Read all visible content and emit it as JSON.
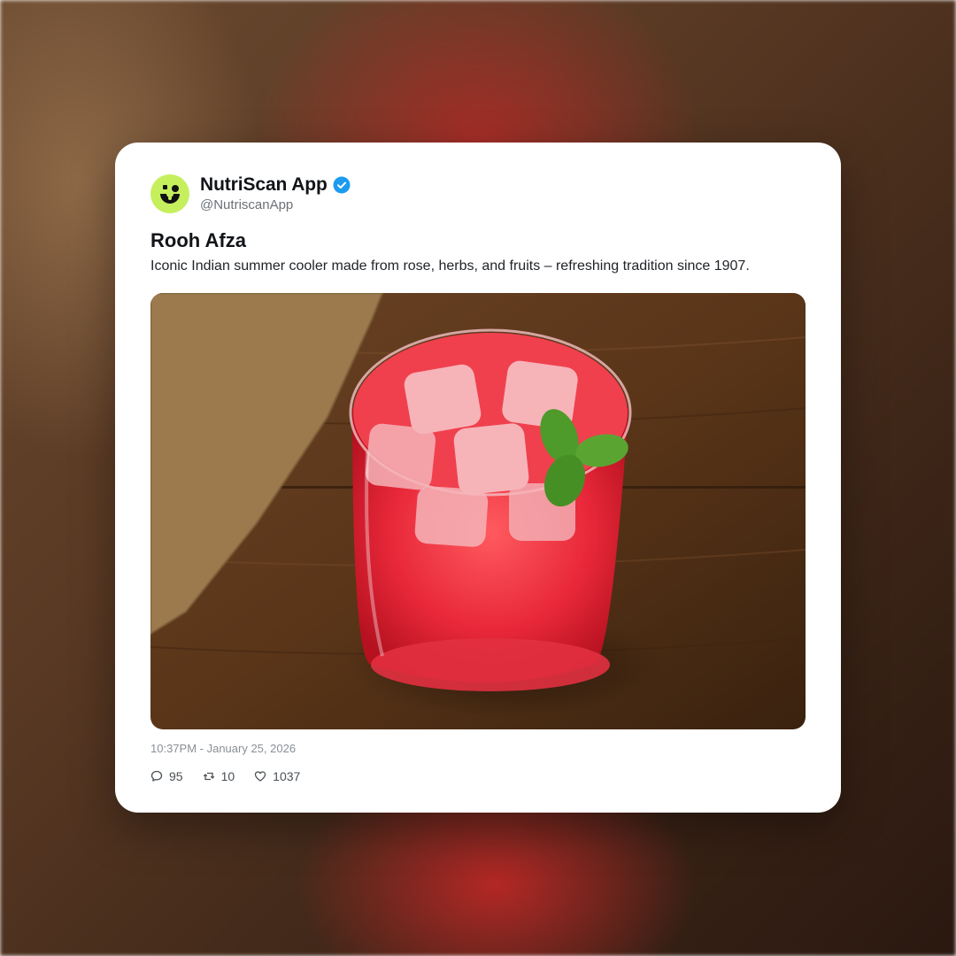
{
  "post": {
    "account_name": "NutriScan App",
    "handle": "@NutriscanApp",
    "verified_icon": "verified-badge-icon",
    "avatar_icon": "nutriscan-logo-icon",
    "title": "Rooh Afza",
    "description": "Iconic Indian summer cooler made from rose, herbs, and fruits – refreshing tradition since 1907.",
    "timestamp": "10:37PM - January 25, 2026",
    "stats": {
      "replies": "95",
      "reposts": "10",
      "likes": "1037"
    }
  },
  "colors": {
    "avatar_bg": "#c6ef5e",
    "verified": "#1d9bf0",
    "drink": "#e8283a"
  }
}
